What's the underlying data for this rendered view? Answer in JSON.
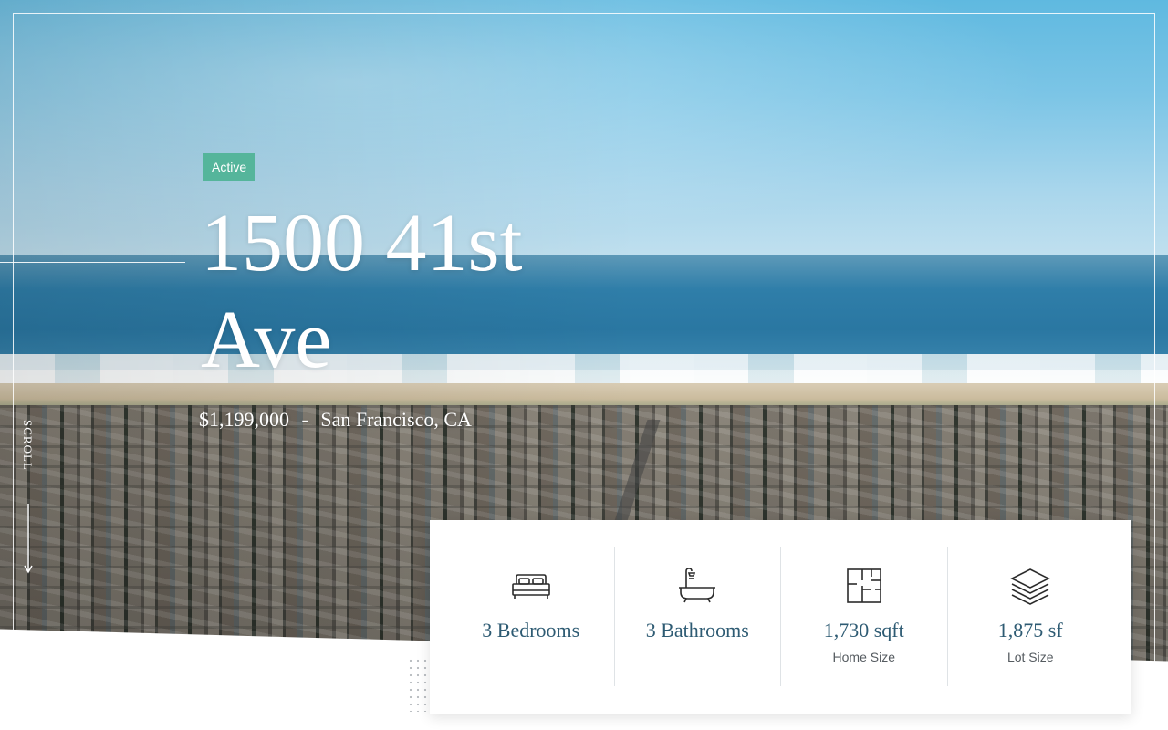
{
  "listing": {
    "status": "Active",
    "address_line1": "1500 41st",
    "address_line2": "Ave",
    "price": "$1,199,000",
    "separator": "-",
    "location": "San Francisco, CA"
  },
  "scroll": {
    "label": "SCROLL"
  },
  "stats": [
    {
      "icon": "bed-icon",
      "value": "3 Bedrooms",
      "label": ""
    },
    {
      "icon": "bathtub-icon",
      "value": "3 Bathrooms",
      "label": ""
    },
    {
      "icon": "floor-plan-icon",
      "value": "1,730 sqft",
      "label": "Home Size"
    },
    {
      "icon": "layers-icon",
      "value": "1,875 sf",
      "label": "Lot Size"
    }
  ],
  "colors": {
    "badge": "#55b59b",
    "stat_value": "#2e5b73",
    "stat_label": "#555b60"
  }
}
